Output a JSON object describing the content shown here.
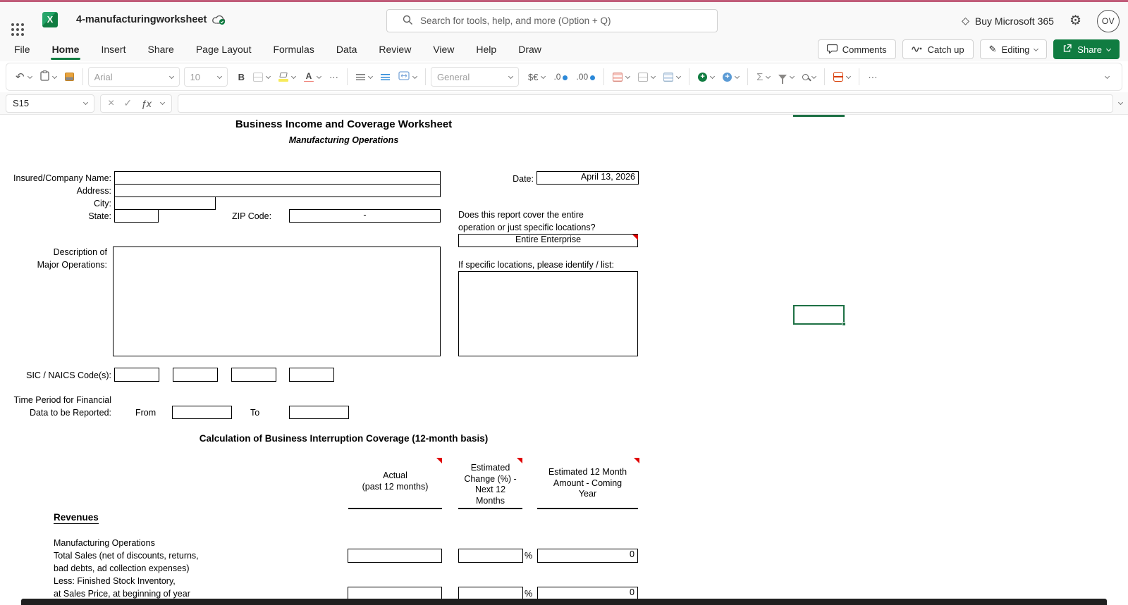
{
  "topbar": {
    "doc_title": "4-manufacturingworksheet",
    "search_placeholder": "Search for tools, help, and more (Option + Q)",
    "buy_label": "Buy Microsoft 365",
    "avatar": "OV"
  },
  "menu": {
    "tabs": [
      "File",
      "Home",
      "Insert",
      "Share",
      "Page Layout",
      "Formulas",
      "Data",
      "Review",
      "View",
      "Help",
      "Draw"
    ],
    "active_tab": "Home",
    "comments": "Comments",
    "catch_up": "Catch up",
    "editing": "Editing",
    "share": "Share"
  },
  "toolbar": {
    "font_name": "Arial",
    "font_size": "10",
    "bold": "B",
    "number_format": "General",
    "currency": "$€",
    "inc_decimal": ".0",
    "dec_decimal": ".00",
    "autosum": "Σ",
    "more": "···"
  },
  "formula_bar": {
    "name_box": "S15",
    "cancel": "×",
    "enter": "✓",
    "fx": "ƒx",
    "value": ""
  },
  "sheet": {
    "title": "Business Income and Coverage Worksheet",
    "subtitle": "Manufacturing Operations",
    "form": {
      "insured_label": "Insured/Company Name:",
      "address_label": "Address:",
      "city_label": "City:",
      "state_label": "State:",
      "zip_label": "ZIP Code:",
      "zip_value": "-",
      "date_label": "Date:",
      "date_value": "April 13, 2026",
      "coverage_q_line1": "Does this report cover the entire",
      "coverage_q_line2": "operation or just specific locations?",
      "coverage_value": "Entire Enterprise",
      "desc_label_line1": "Description of",
      "desc_label_line2": "Major Operations:",
      "specific_label": "If specific locations, please identify / list:",
      "sic_label": "SIC / NAICS Code(s):",
      "period_label_line1": "Time Period for Financial",
      "period_label_line2": "Data to be Reported:",
      "from_label": "From",
      "to_label": "To"
    },
    "calc": {
      "title": "Calculation of Business Interruption Coverage (12-month basis)",
      "col1": "Actual\n(past 12 months)",
      "col2": "Estimated\nChange (%) -\nNext 12\nMonths",
      "col3": "Estimated 12 Month\nAmount - Coming\nYear",
      "revenues_heading": "Revenues",
      "row_group": "Manufacturing Operations",
      "row1_line1": "Total Sales (net of  discounts, returns,",
      "row1_line2": "bad debts, ad collection expenses)",
      "row2_line1": "Less: Finished Stock Inventory,",
      "row2_line2": "at Sales Price, at beginning of year",
      "percent": "%",
      "amount_value": "0"
    }
  }
}
